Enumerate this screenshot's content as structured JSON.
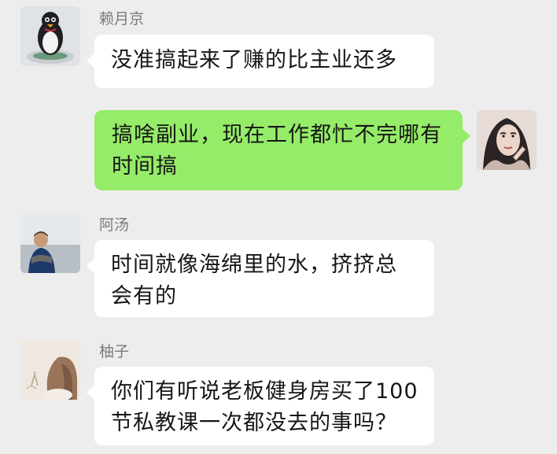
{
  "messages": [
    {
      "sender": "赖月京",
      "text": "没准搞起来了赚的比主业还多",
      "direction": "incoming",
      "avatar_icon": "penguin-avatar-icon"
    },
    {
      "sender": "",
      "text": "搞啥副业，现在工作都忙不完哪有时间搞",
      "direction": "outgoing",
      "avatar_icon": "woman-portrait-avatar-icon"
    },
    {
      "sender": "阿汤",
      "text": "时间就像海绵里的水，挤挤总会有的",
      "direction": "incoming",
      "avatar_icon": "person-by-sea-avatar-icon"
    },
    {
      "sender": "柚子",
      "text": "你们有听说老板健身房买了100节私教课一次都没去的事吗？",
      "direction": "incoming",
      "avatar_icon": "woman-back-avatar-icon"
    }
  ],
  "colors": {
    "background": "#ededed",
    "incoming_bubble": "#ffffff",
    "outgoing_bubble": "#95ec69",
    "sender_name": "#7a7a7a",
    "text": "#161616"
  }
}
